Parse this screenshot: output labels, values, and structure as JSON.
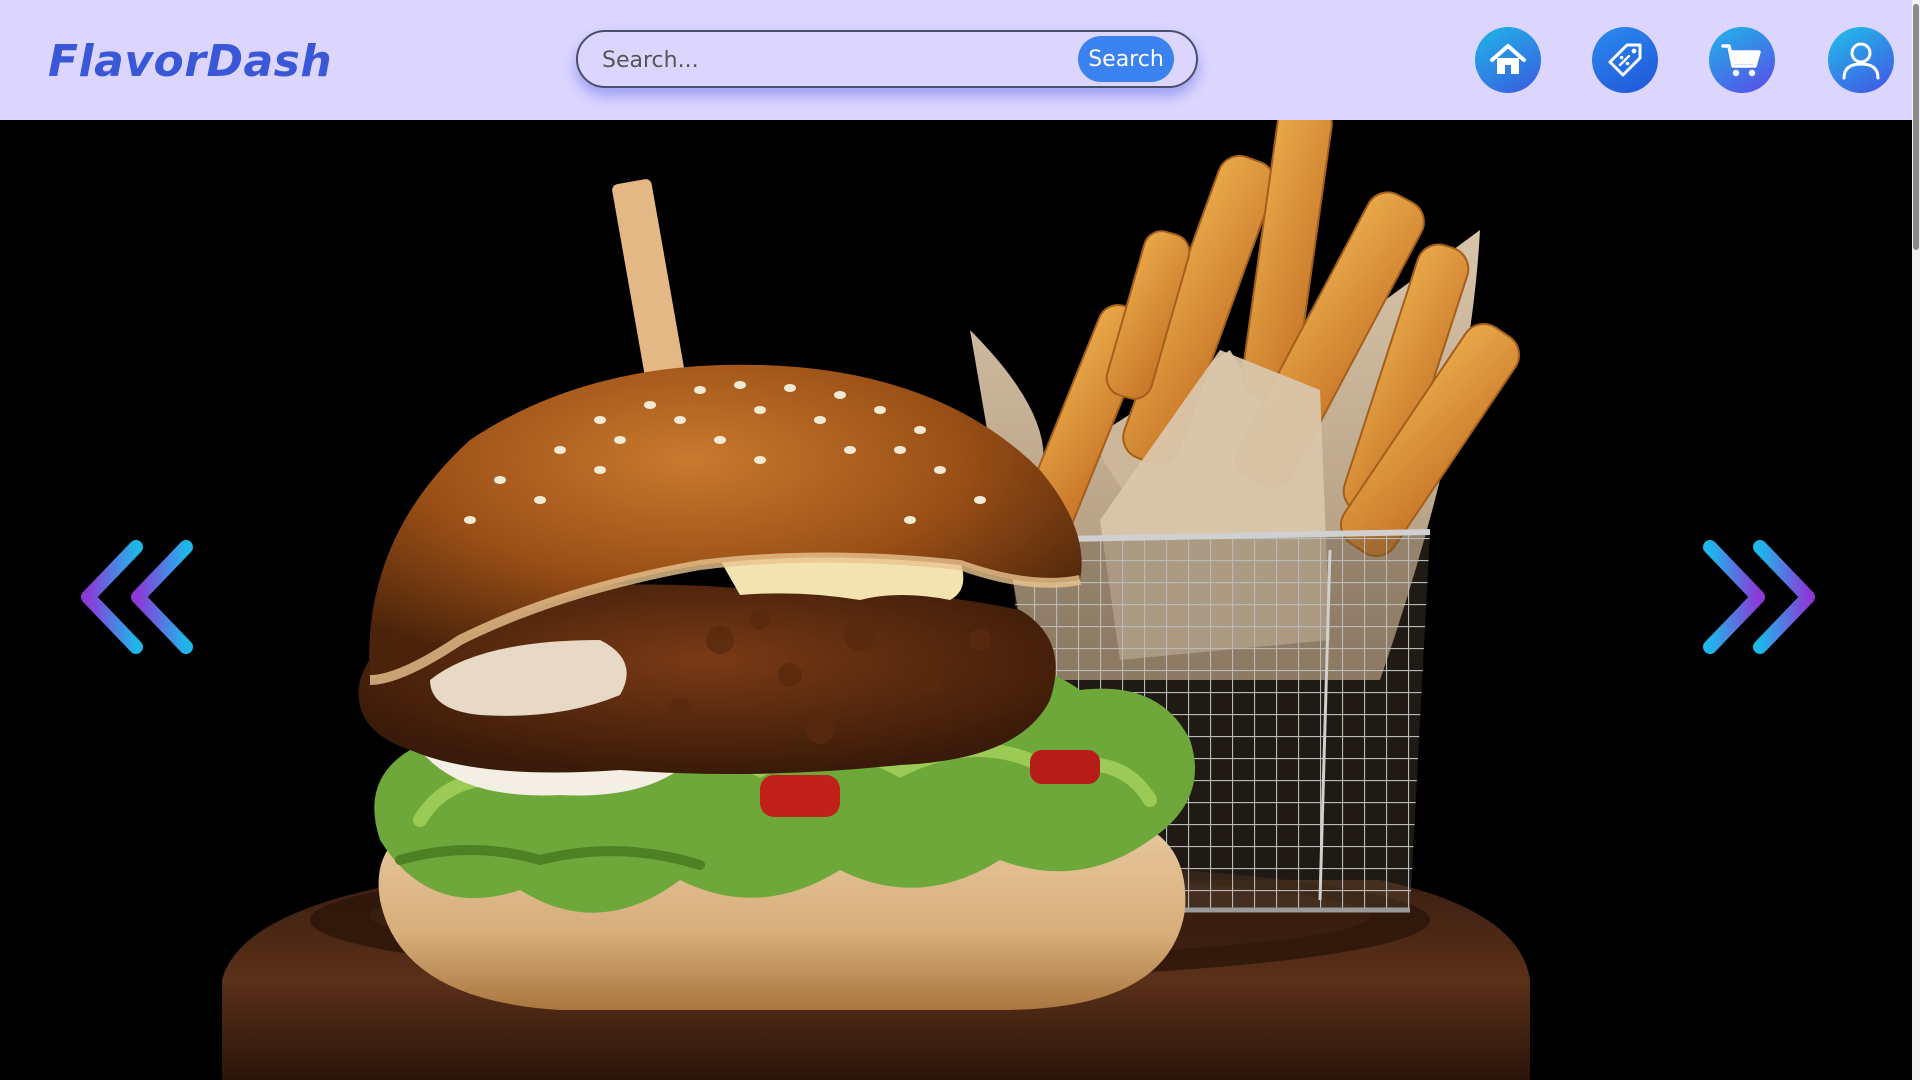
{
  "app": {
    "name": "FlavorDash"
  },
  "search": {
    "placeholder": "Search...",
    "button_label": "Search"
  },
  "nav": {
    "icons": [
      "home-icon",
      "offers-tag-icon",
      "cart-icon",
      "profile-icon"
    ]
  },
  "hero": {
    "image": "burger-and-fries-photo",
    "prev_icon": "double-chevron-left-icon",
    "next_icon": "double-chevron-right-icon"
  },
  "colors": {
    "header_bg": "#dcd6ff",
    "logo": "#3a57d8",
    "search_button": "#3a82f0",
    "hero_bg": "#000000"
  }
}
